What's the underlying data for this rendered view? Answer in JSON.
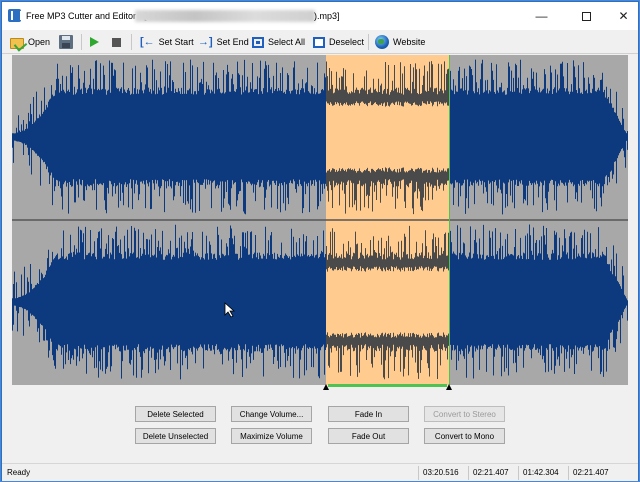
{
  "window": {
    "title_prefix": "Free MP3 Cutter and Editor - [",
    "title_suffix": ").mp3]",
    "minimize": "—",
    "close": "✕"
  },
  "toolbar": {
    "open": "Open",
    "set_start": "Set Start",
    "set_end": "Set End",
    "select_all": "Select All",
    "deselect": "Deselect",
    "website": "Website",
    "set_start_icon": "[←",
    "set_end_icon": "→]"
  },
  "buttons": {
    "delete_selected": "Delete Selected",
    "delete_unselected": "Delete Unselected",
    "change_volume": "Change Volume...",
    "maximize_volume": "Maximize Volume",
    "fade_in": "Fade In",
    "fade_out": "Fade Out",
    "convert_to_stereo": "Convert to Stereo",
    "convert_to_mono": "Convert to Mono"
  },
  "status": {
    "state": "Ready",
    "total_length": "03:20.516",
    "selection_start": "02:21.407",
    "selection_end": "01:42.304",
    "cursor_position": "02:21.407"
  },
  "colors": {
    "waveform": "#0d3a7e",
    "selection": "#ffcb8f",
    "selected_waveform": "#4a4a4a",
    "background": "#a8a8a8",
    "marker": "#4fc24f"
  },
  "selection": {
    "start_fraction": 0.51,
    "end_fraction": 0.71
  }
}
